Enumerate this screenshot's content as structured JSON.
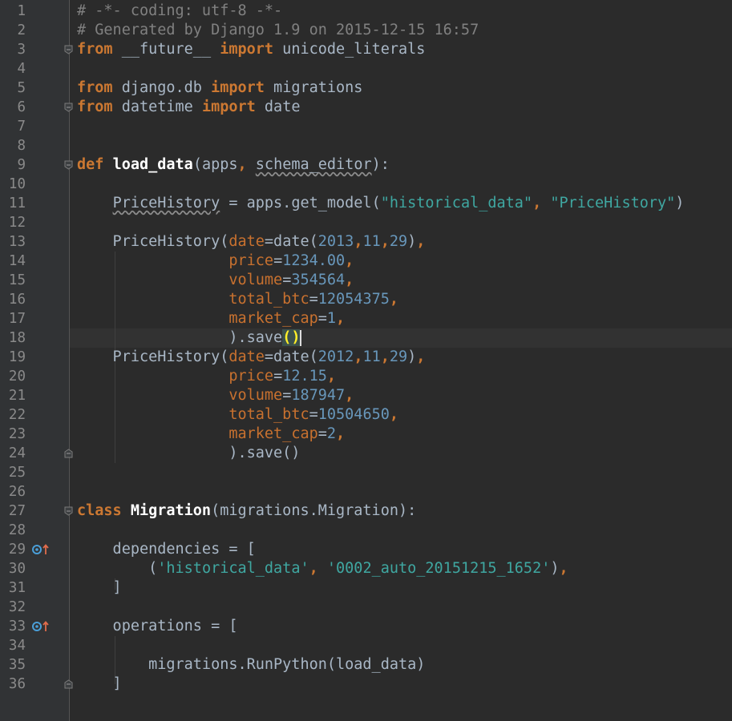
{
  "editor": {
    "line_numbers": [
      "1",
      "2",
      "3",
      "4",
      "5",
      "6",
      "7",
      "8",
      "9",
      "10",
      "11",
      "12",
      "13",
      "14",
      "15",
      "16",
      "17",
      "18",
      "19",
      "20",
      "21",
      "22",
      "23",
      "24",
      "25",
      "26",
      "27",
      "28",
      "29",
      "30",
      "31",
      "32",
      "33",
      "34",
      "35",
      "36"
    ],
    "lines": [
      [
        {
          "t": "# -*- coding: utf-8 -*-",
          "c": "c"
        }
      ],
      [
        {
          "t": "# Generated by Django 1.9 on 2015-12-15 16:57",
          "c": "c"
        }
      ],
      [
        {
          "t": "from",
          "c": "k"
        },
        {
          "t": " __future__ "
        },
        {
          "t": "import",
          "c": "k"
        },
        {
          "t": " unicode_literals"
        }
      ],
      [],
      [
        {
          "t": "from",
          "c": "k"
        },
        {
          "t": " django.db "
        },
        {
          "t": "import",
          "c": "k"
        },
        {
          "t": " migrations"
        }
      ],
      [
        {
          "t": "from",
          "c": "k"
        },
        {
          "t": " datetime "
        },
        {
          "t": "import",
          "c": "k"
        },
        {
          "t": " date"
        }
      ],
      [],
      [],
      [
        {
          "t": "def ",
          "c": "k"
        },
        {
          "t": "load_data",
          "c": "b"
        },
        {
          "t": "(apps"
        },
        {
          "t": ", ",
          "c": "k"
        },
        {
          "t": "schema_editor",
          "c": "w"
        },
        {
          "t": "):"
        }
      ],
      [],
      [
        {
          "t": "    "
        },
        {
          "t": "PriceHistory",
          "c": "w"
        },
        {
          "t": " = apps.get_model("
        },
        {
          "t": "\"historical_data\"",
          "c": "s2"
        },
        {
          "t": ", ",
          "c": "k"
        },
        {
          "t": "\"PriceHistory\"",
          "c": "s2"
        },
        {
          "t": ")"
        }
      ],
      [],
      [
        {
          "t": "    PriceHistory("
        },
        {
          "t": "date",
          "c": "p"
        },
        {
          "t": "=date("
        },
        {
          "t": "2013",
          "c": "n"
        },
        {
          "t": ",",
          "c": "k"
        },
        {
          "t": "11",
          "c": "n"
        },
        {
          "t": ",",
          "c": "k"
        },
        {
          "t": "29",
          "c": "n"
        },
        {
          "t": ")"
        },
        {
          "t": ",",
          "c": "k"
        }
      ],
      [
        {
          "t": "                 "
        },
        {
          "t": "price",
          "c": "p"
        },
        {
          "t": "="
        },
        {
          "t": "1234.00",
          "c": "n"
        },
        {
          "t": ",",
          "c": "k"
        }
      ],
      [
        {
          "t": "                 "
        },
        {
          "t": "volume",
          "c": "p"
        },
        {
          "t": "="
        },
        {
          "t": "354564",
          "c": "n"
        },
        {
          "t": ",",
          "c": "k"
        }
      ],
      [
        {
          "t": "                 "
        },
        {
          "t": "total_btc",
          "c": "p"
        },
        {
          "t": "="
        },
        {
          "t": "12054375",
          "c": "n"
        },
        {
          "t": ",",
          "c": "k"
        }
      ],
      [
        {
          "t": "                 "
        },
        {
          "t": "market_cap",
          "c": "p"
        },
        {
          "t": "="
        },
        {
          "t": "1",
          "c": "n"
        },
        {
          "t": ",",
          "c": "k"
        }
      ],
      [
        {
          "t": "                 ).save"
        },
        {
          "t": "()",
          "c": "bm"
        },
        {
          "t": "",
          "c": "caret"
        }
      ],
      [
        {
          "t": "    PriceHistory("
        },
        {
          "t": "date",
          "c": "p"
        },
        {
          "t": "=date("
        },
        {
          "t": "2012",
          "c": "n"
        },
        {
          "t": ",",
          "c": "k"
        },
        {
          "t": "11",
          "c": "n"
        },
        {
          "t": ",",
          "c": "k"
        },
        {
          "t": "29",
          "c": "n"
        },
        {
          "t": ")"
        },
        {
          "t": ",",
          "c": "k"
        }
      ],
      [
        {
          "t": "                 "
        },
        {
          "t": "price",
          "c": "p"
        },
        {
          "t": "="
        },
        {
          "t": "12.15",
          "c": "n"
        },
        {
          "t": ",",
          "c": "k"
        }
      ],
      [
        {
          "t": "                 "
        },
        {
          "t": "volume",
          "c": "p"
        },
        {
          "t": "="
        },
        {
          "t": "187947",
          "c": "n"
        },
        {
          "t": ",",
          "c": "k"
        }
      ],
      [
        {
          "t": "                 "
        },
        {
          "t": "total_btc",
          "c": "p"
        },
        {
          "t": "="
        },
        {
          "t": "10504650",
          "c": "n"
        },
        {
          "t": ",",
          "c": "k"
        }
      ],
      [
        {
          "t": "                 "
        },
        {
          "t": "market_cap",
          "c": "p"
        },
        {
          "t": "="
        },
        {
          "t": "2",
          "c": "n"
        },
        {
          "t": ",",
          "c": "k"
        }
      ],
      [
        {
          "t": "                 ).save()"
        }
      ],
      [],
      [],
      [
        {
          "t": "class ",
          "c": "k"
        },
        {
          "t": "Migration",
          "c": "b"
        },
        {
          "t": "(migrations.Migration):"
        }
      ],
      [],
      [
        {
          "t": "    dependencies = ["
        }
      ],
      [
        {
          "t": "        ("
        },
        {
          "t": "'historical_data'",
          "c": "s2"
        },
        {
          "t": ", ",
          "c": "k"
        },
        {
          "t": "'0002_auto_20151215_1652'",
          "c": "s2"
        },
        {
          "t": ")"
        },
        {
          "t": ",",
          "c": "k"
        }
      ],
      [
        {
          "t": "    ]"
        }
      ],
      [],
      [
        {
          "t": "    operations = ["
        }
      ],
      [],
      [
        {
          "t": "        migrations.RunPython(load_data)"
        }
      ],
      [
        {
          "t": "    ]"
        }
      ]
    ],
    "fold_markers": [
      2,
      5,
      8,
      23,
      26,
      35
    ],
    "override_markers": [
      28,
      32
    ],
    "icons": {
      "fold": "fold-marker-icon",
      "override": "override-method-icon"
    },
    "colors": {
      "keyword": "#cc7832",
      "comment": "#808080",
      "string": "#3fa7a1",
      "number": "#6897bb",
      "param": "#c8712f",
      "text": "#a9b7c6",
      "background": "#2b2b2b",
      "gutter": "#313335",
      "brace_match": "#ffef28"
    }
  }
}
